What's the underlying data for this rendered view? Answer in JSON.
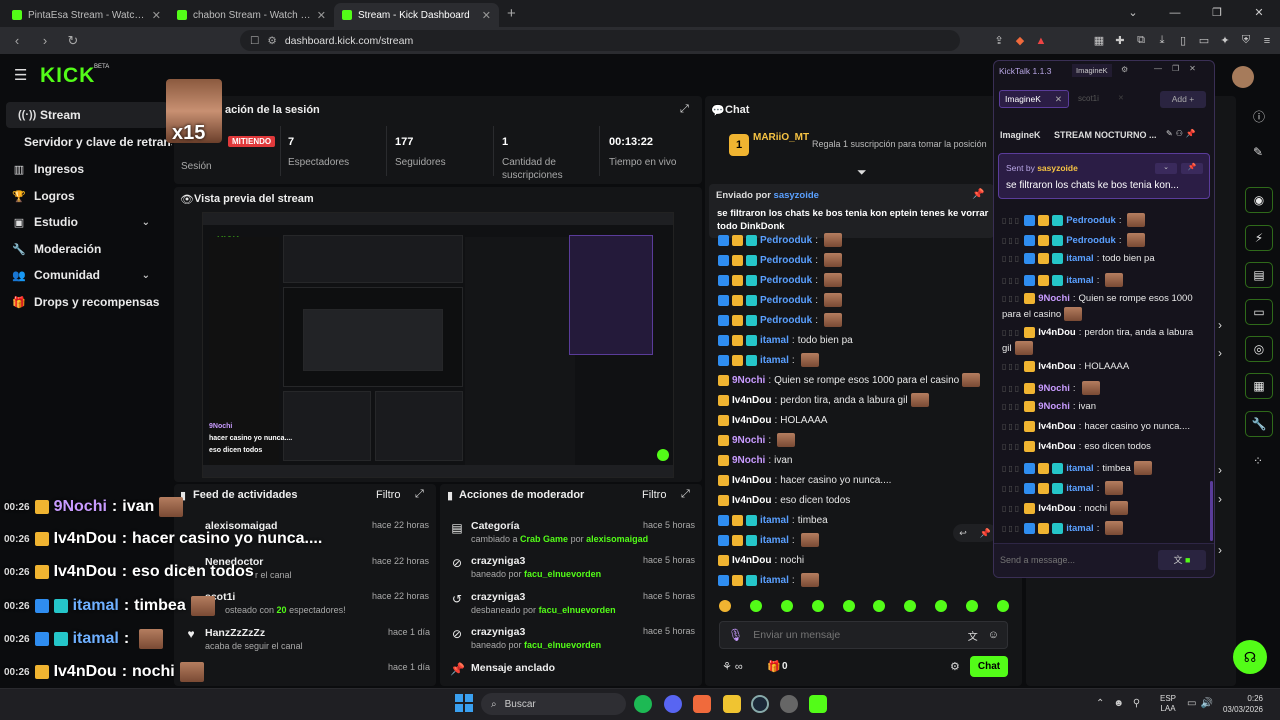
{
  "browser": {
    "tabs": [
      {
        "title": "PintaEsa Stream - Watch Live on Kick",
        "active": false
      },
      {
        "title": "chabon Stream - Watch Live on K",
        "active": false
      },
      {
        "title": "Stream - Kick Dashboard",
        "active": true
      }
    ],
    "url": "dashboard.kick.com/stream"
  },
  "app": {
    "logo": "KICK",
    "beta": "BETA"
  },
  "sticker": {
    "text": "x15"
  },
  "sidebar": {
    "items": [
      {
        "label": "Stream"
      },
      {
        "label": "Servidor y clave de retransmisión"
      },
      {
        "label": "Ingresos"
      },
      {
        "label": "Logros"
      },
      {
        "label": "Estudio"
      },
      {
        "label": "Moderación"
      },
      {
        "label": "Comunidad"
      },
      {
        "label": "Drops y recompensas"
      }
    ]
  },
  "session": {
    "title": "ación de la sesión",
    "badge": "MITIENDO",
    "stats": [
      {
        "value": "",
        "label": "Sesión"
      },
      {
        "value": "7",
        "label": "Espectadores"
      },
      {
        "value": "177",
        "label": "Seguidores"
      },
      {
        "value": "1",
        "label": "Cantidad de suscripciones"
      },
      {
        "value": "00:13:22",
        "label": "Tiempo en vivo"
      }
    ]
  },
  "preview": {
    "title": "Vista previa del stream"
  },
  "activity": {
    "title": "Feed de actividades",
    "filter": "Filtro",
    "items": [
      {
        "name": "alexisomaigad",
        "sub": "",
        "time": "hace 22 horas"
      },
      {
        "name": "Nenedoctor",
        "sub": "r el canal",
        "time": "hace 22 horas"
      },
      {
        "name": "scot1i",
        "sub_prefix": "osteado con ",
        "sub_num": "20",
        "sub_suffix": " espectadores!",
        "time": "hace 22 horas"
      },
      {
        "name": "HanzZzZzZz",
        "sub": "acaba de seguir el canal",
        "time": "hace 1 día"
      },
      {
        "name": "",
        "sub": "",
        "time": "hace 1 día"
      }
    ]
  },
  "modactions": {
    "title": "Acciones de moderador",
    "filter": "Filtro",
    "items": [
      {
        "title": "Categoría",
        "sub_a": "cambiado a ",
        "sub_b": "Crab Game",
        "sub_c": " por ",
        "sub_d": "alexisomaigad",
        "time": "hace 5 horas"
      },
      {
        "title": "crazyniga3",
        "sub_a": "baneado por ",
        "sub_b": "facu_elnuevorden",
        "time": "hace 5 horas"
      },
      {
        "title": "crazyniga3",
        "sub_a": "desbaneado por ",
        "sub_b": "facu_elnuevorden",
        "time": "hace 5 horas"
      },
      {
        "title": "crazyniga3",
        "sub_a": "baneado por ",
        "sub_b": "facu_elnuevorden",
        "time": "hace 5 horas"
      },
      {
        "title": "Mensaje anclado",
        "sub_a": "",
        "sub_b": "",
        "time": ""
      }
    ]
  },
  "chat": {
    "title": "Chat",
    "sub_user": "MARiiO_MT",
    "sub_msg": "Regala 1 suscripción para tomar la posición",
    "pinned_by_label": "Enviado por",
    "pinned_by": "sasyzoide",
    "pinned_text": "se filtraron los chats ke bos tenia kon eptein tenes ke vorrar todo DinkDonk",
    "messages": [
      {
        "user": "Pedrooduk",
        "text": "",
        "color": "blue"
      },
      {
        "user": "Pedrooduk",
        "text": "",
        "color": "blue"
      },
      {
        "user": "Pedrooduk",
        "text": "",
        "color": "blue"
      },
      {
        "user": "Pedrooduk",
        "text": "",
        "color": "blue"
      },
      {
        "user": "Pedrooduk",
        "text": "",
        "color": "blue"
      },
      {
        "user": "itamal",
        "text": "todo bien pa",
        "color": "blue"
      },
      {
        "user": "itamal",
        "text": "",
        "color": "blue"
      },
      {
        "user": "9Nochi",
        "text": "Quien se rompe esos 1000 para el casino",
        "color": "purple"
      },
      {
        "user": "Iv4nDou",
        "text": "perdon tira, anda a labura gil",
        "color": "white"
      },
      {
        "user": "Iv4nDou",
        "text": "HOLAAAA",
        "color": "white"
      },
      {
        "user": "9Nochi",
        "text": "",
        "color": "purple"
      },
      {
        "user": "9Nochi",
        "text": "ivan",
        "color": "purple"
      },
      {
        "user": "Iv4nDou",
        "text": "hacer casino yo nunca....",
        "color": "white"
      },
      {
        "user": "Iv4nDou",
        "text": "eso dicen todos",
        "color": "white"
      },
      {
        "user": "itamal",
        "text": "timbea",
        "color": "blue"
      },
      {
        "user": "itamal",
        "text": "",
        "color": "blue"
      },
      {
        "user": "Iv4nDou",
        "text": "nochi",
        "color": "white"
      },
      {
        "user": "itamal",
        "text": "",
        "color": "blue"
      }
    ],
    "input_placeholder": "Enviar un mensaje",
    "points": "0",
    "send_label": "Chat"
  },
  "overlay": {
    "lines": [
      {
        "time": "00:26",
        "user": "9Nochi",
        "text": "ivan",
        "color": "purple"
      },
      {
        "time": "00:26",
        "user": "Iv4nDou",
        "text": "hacer casino yo nunca....",
        "color": "white"
      },
      {
        "time": "00:26",
        "user": "Iv4nDou",
        "text": "eso dicen todos",
        "color": "white"
      },
      {
        "time": "00:26",
        "user": "itamal",
        "text": "timbea",
        "color": "blue"
      },
      {
        "time": "00:26",
        "user": "itamal",
        "text": "",
        "color": "blue"
      },
      {
        "time": "00:26",
        "user": "Iv4nDou",
        "text": "nochi",
        "color": "white"
      },
      {
        "time": "00:26",
        "user": "itamal",
        "text": "",
        "color": "blue"
      }
    ]
  },
  "kicktalk": {
    "title": "KickTalk 1.1.3",
    "tab_top": "ImagineK",
    "tab_active": "ImagineK",
    "tab_other": "scot1i",
    "add_label": "Add",
    "stream_user": "ImagineK",
    "stream_title": "STREAM NOCTURNO ...",
    "sent_by_label": "Sent by",
    "sent_by": "sasyzoide",
    "pinned_text": "se filtraron los chats ke bos tenia kon...",
    "messages": [
      {
        "user": "Pedrooduk",
        "text": "",
        "color": "blue"
      },
      {
        "user": "Pedrooduk",
        "text": "",
        "color": "blue"
      },
      {
        "user": "itamal",
        "text": "todo bien pa",
        "color": "blue"
      },
      {
        "user": "itamal",
        "text": "",
        "color": "blue"
      },
      {
        "user": "9Nochi",
        "text": "Quien se rompe esos 1000",
        "text2": "para el casino",
        "color": "purple"
      },
      {
        "user": "Iv4nDou",
        "text": "perdon tira, anda a labura",
        "text2": "gil",
        "color": "white"
      },
      {
        "user": "Iv4nDou",
        "text": "HOLAAAA",
        "color": "white"
      },
      {
        "user": "9Nochi",
        "text": "",
        "color": "purple"
      },
      {
        "user": "9Nochi",
        "text": "ivan",
        "color": "purple"
      },
      {
        "user": "Iv4nDou",
        "text": "hacer casino yo nunca....",
        "color": "white"
      },
      {
        "user": "Iv4nDou",
        "text": "eso dicen todos",
        "color": "white"
      },
      {
        "user": "itamal",
        "text": "timbea",
        "color": "blue"
      },
      {
        "user": "itamal",
        "text": "",
        "color": "blue"
      },
      {
        "user": "Iv4nDou",
        "text": "nochi",
        "color": "white"
      },
      {
        "user": "itamal",
        "text": "",
        "color": "blue"
      }
    ],
    "input_placeholder": "Send a message..."
  },
  "taskbar": {
    "search": "Buscar",
    "lang": "ESP",
    "lang2": "LAA",
    "time": "0:26",
    "date": "03/03/2026"
  },
  "colors": {
    "accent": "#53fc18",
    "user_blue": "#5aa0ff",
    "user_purple": "#c89bff",
    "kicktalk_bg": "#15131c"
  }
}
